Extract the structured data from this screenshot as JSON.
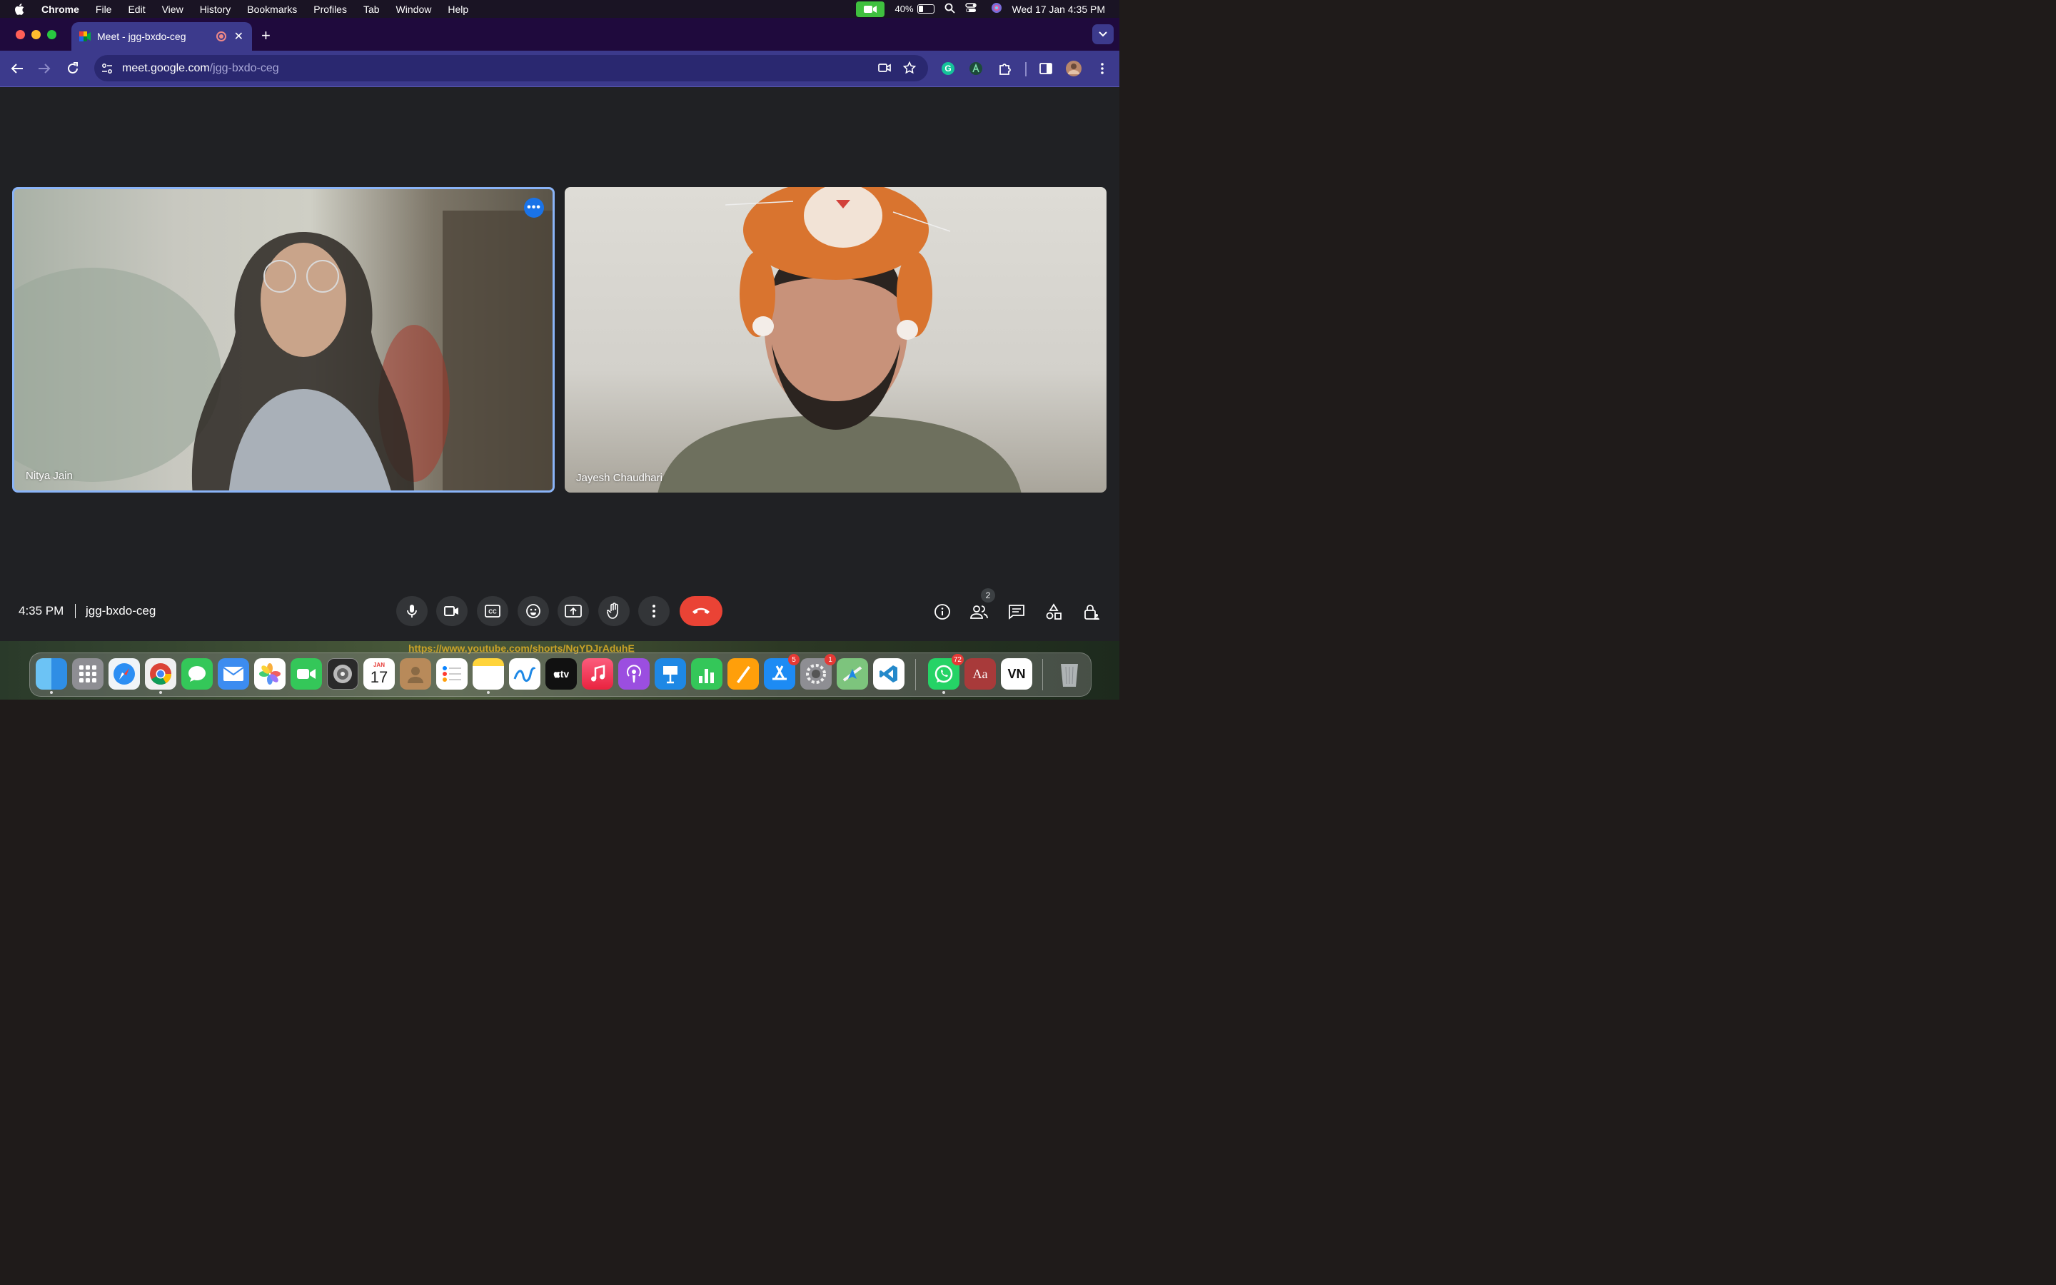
{
  "menubar": {
    "app": "Chrome",
    "items": [
      "File",
      "Edit",
      "View",
      "History",
      "Bookmarks",
      "Profiles",
      "Tab",
      "Window",
      "Help"
    ],
    "battery_percent": "40%",
    "battery_level": 0.4,
    "datetime": "Wed 17 Jan  4:35 PM"
  },
  "browser": {
    "tab_title": "Meet - jgg-bxdo-ceg",
    "url_host": "meet.google.com",
    "url_path": "/jgg-bxdo-ceg"
  },
  "meet": {
    "participants": [
      {
        "name": "Nitya Jain",
        "pinned_menu": "•••"
      },
      {
        "name": "Jayesh Chaudhari"
      }
    ],
    "time": "4:35 PM",
    "meeting_code": "jgg-bxdo-ceg",
    "participant_count": "2"
  },
  "background_link": "https://www.youtube.com/shorts/NgYDJrAduhE",
  "dock": {
    "calendar_month": "JAN",
    "calendar_day": "17",
    "badges": {
      "appstore": "5",
      "settings": "1",
      "whatsapp": "72"
    },
    "dictionary_label": "Aa",
    "vn_label": "VN",
    "tv_label": "tv"
  },
  "colors": {
    "accent": "#8ab4f8",
    "end_call": "#ea4335",
    "chrome_toolbar": "#3c3a8c"
  }
}
